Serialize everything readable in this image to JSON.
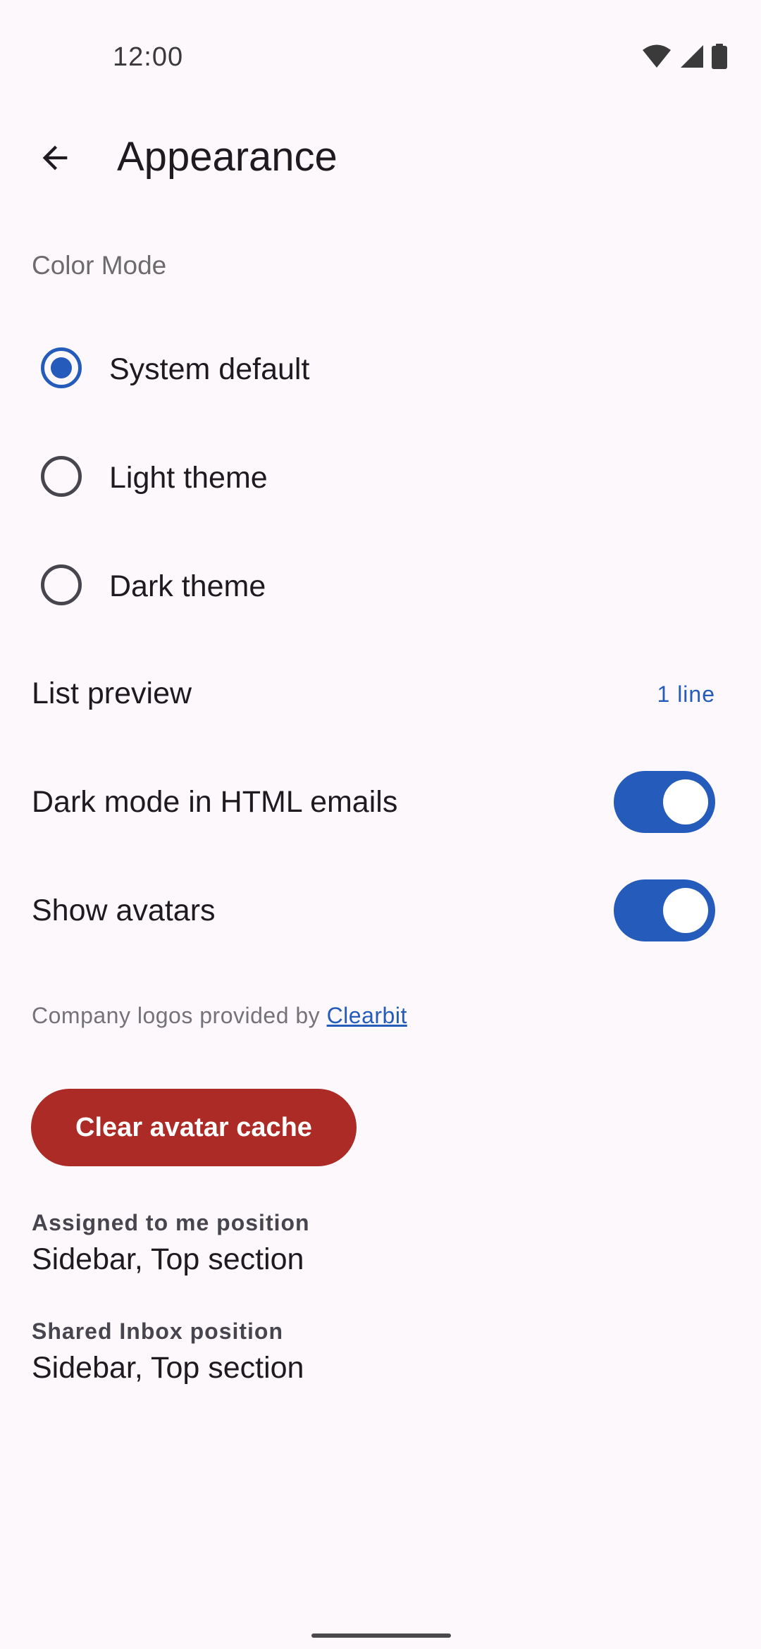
{
  "status_bar": {
    "time": "12:00",
    "icons": [
      "wifi-icon",
      "cell-signal-icon",
      "battery-icon"
    ]
  },
  "top_bar": {
    "back_icon": "arrow-back-icon",
    "title": "Appearance"
  },
  "color_mode": {
    "header": "Color Mode",
    "options": [
      {
        "label": "System default",
        "selected": true
      },
      {
        "label": "Light theme",
        "selected": false
      },
      {
        "label": "Dark theme",
        "selected": false
      }
    ]
  },
  "list_preview": {
    "label": "List preview",
    "value": "1 line"
  },
  "dark_mode_html": {
    "label": "Dark mode in HTML emails",
    "enabled": true
  },
  "show_avatars": {
    "label": "Show avatars",
    "enabled": true
  },
  "footnote": {
    "prefix": "Company logos provided by ",
    "link": "Clearbit"
  },
  "clear_cache_button": {
    "label": "Clear avatar cache"
  },
  "assigned_position": {
    "label": "Assigned to me position",
    "value": "Sidebar, Top section"
  },
  "shared_inbox_position": {
    "label": "Shared Inbox position",
    "value": "Sidebar, Top section"
  },
  "colors": {
    "accent": "#255cbc",
    "danger": "#ad2b26",
    "background": "#fdf8fc"
  }
}
